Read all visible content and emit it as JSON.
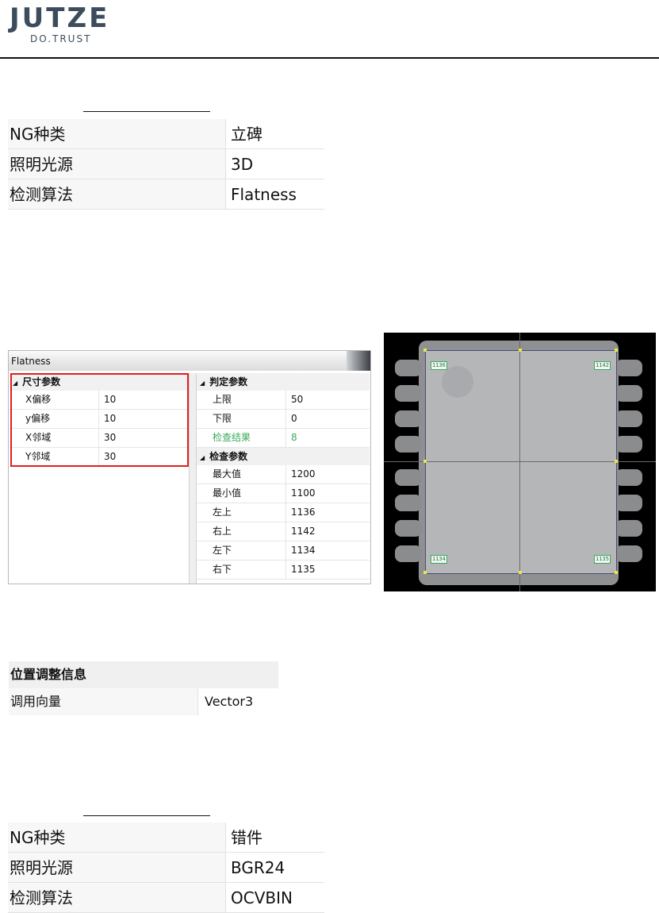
{
  "header": {
    "brand": "JUTZE",
    "tagline": "DO.TRUST"
  },
  "table1": [
    {
      "key": "NG种类",
      "value": "立碑"
    },
    {
      "key": "照明光源",
      "value": "3D"
    },
    {
      "key": "检测算法",
      "value": "Flatness"
    }
  ],
  "flatness_window": {
    "title": "Flatness",
    "left_group": "尺寸参数",
    "left_rows": [
      {
        "key": "X偏移",
        "value": "10"
      },
      {
        "key": "y偏移",
        "value": "10"
      },
      {
        "key": "X邻域",
        "value": "30"
      },
      {
        "key": "Y邻域",
        "value": "30"
      }
    ],
    "right_group1": "判定参数",
    "right_rows1": [
      {
        "key": "上限",
        "value": "50"
      },
      {
        "key": "下限",
        "value": "0"
      },
      {
        "key": "检查结果",
        "value": "8"
      }
    ],
    "right_group2": "检查参数",
    "right_rows2": [
      {
        "key": "最大值",
        "value": "1200"
      },
      {
        "key": "最小值",
        "value": "1100"
      },
      {
        "key": "左上",
        "value": "1136"
      },
      {
        "key": "右上",
        "value": "1142"
      },
      {
        "key": "左下",
        "value": "1134"
      },
      {
        "key": "右下",
        "value": "1135"
      }
    ]
  },
  "inspection_image": {
    "labels": {
      "top_left": "1136",
      "top_right": "1142",
      "bottom_left": "1134",
      "bottom_right": "1135"
    },
    "colors": {
      "outline": "#4a4a78",
      "marker": "#e8e84a",
      "label": "#1a7f3a"
    }
  },
  "position_info": {
    "header": "位置调整信息",
    "key": "调用向量",
    "value": "Vector3"
  },
  "table2": [
    {
      "key": "NG种类",
      "value": "错件"
    },
    {
      "key": "照明光源",
      "value": "BGR24"
    },
    {
      "key": "检测算法",
      "value": "OCVBIN"
    }
  ]
}
